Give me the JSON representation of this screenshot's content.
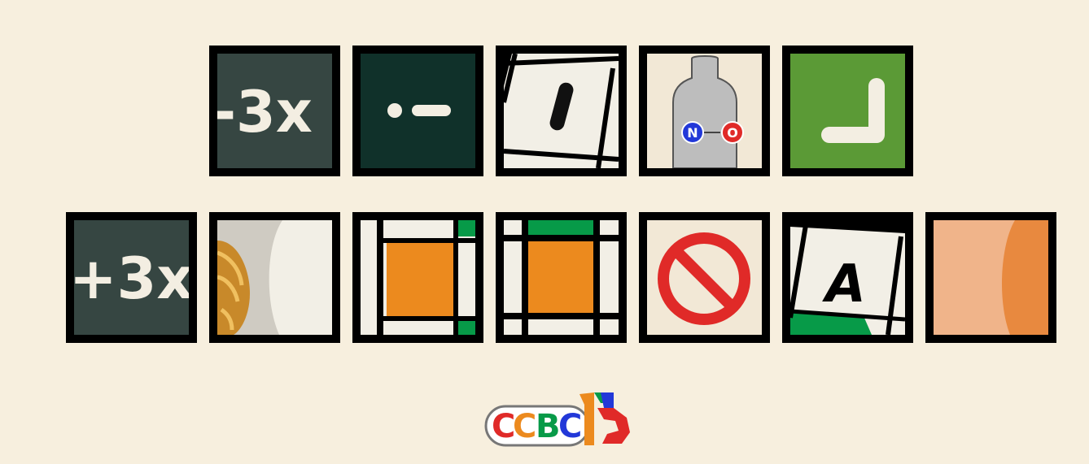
{
  "puzzle": {
    "row1": [
      {
        "id": "tile-minus-3x",
        "text": "-3x"
      },
      {
        "id": "tile-dot-dash",
        "text": ""
      },
      {
        "id": "tile-letter-l",
        "text": "l"
      },
      {
        "id": "tile-no-cylinder",
        "text": "",
        "atoms": [
          "N",
          "O"
        ]
      },
      {
        "id": "tile-corner-l",
        "text": ""
      }
    ],
    "row2": [
      {
        "id": "tile-plus-3x",
        "text": "+3x"
      },
      {
        "id": "tile-pasta",
        "text": ""
      },
      {
        "id": "tile-orange-square-1",
        "text": ""
      },
      {
        "id": "tile-orange-square-2",
        "text": ""
      },
      {
        "id": "tile-prohibited",
        "text": ""
      },
      {
        "id": "tile-letter-a",
        "text": "A"
      },
      {
        "id": "tile-orange-shape",
        "text": ""
      }
    ]
  },
  "logo": {
    "letters": [
      "C",
      "C",
      "B",
      "C"
    ],
    "number": "15"
  },
  "colors": {
    "background": "#f7efde",
    "tile_border": "#000000",
    "chalkboard": "#364642",
    "dark_green": "#10312a",
    "paper": "#f2efe6",
    "grass_green": "#5b9a36",
    "orange": "#ec8a1e",
    "green_accent": "#079a48",
    "red": "#e02a28",
    "cylinder_grey": "#bdbdbd",
    "blue_atom": "#2238d8",
    "peach": "#f0b48a",
    "peach_dark": "#e8893f"
  }
}
